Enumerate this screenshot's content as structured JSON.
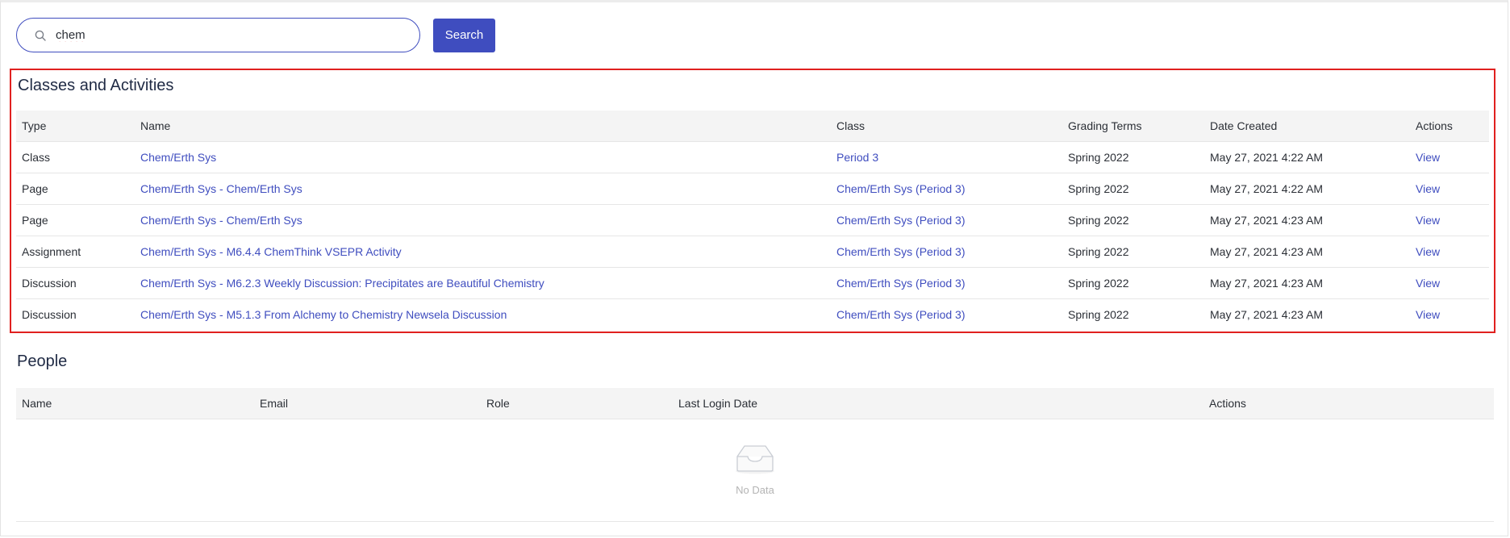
{
  "search": {
    "value": "chem",
    "button_label": "Search"
  },
  "classes": {
    "title": "Classes and Activities",
    "columns": {
      "type": "Type",
      "name": "Name",
      "class": "Class",
      "grading_terms": "Grading Terms",
      "date_created": "Date Created",
      "actions": "Actions"
    },
    "rows": [
      {
        "type": "Class",
        "name": "Chem/Erth Sys",
        "class": "Period 3",
        "grading_terms": "Spring 2022",
        "date_created": "May 27, 2021 4:22 AM",
        "action": "View"
      },
      {
        "type": "Page",
        "name": "Chem/Erth Sys - Chem/Erth Sys",
        "class": "Chem/Erth Sys (Period 3)",
        "grading_terms": "Spring 2022",
        "date_created": "May 27, 2021 4:22 AM",
        "action": "View"
      },
      {
        "type": "Page",
        "name": "Chem/Erth Sys - Chem/Erth Sys",
        "class": "Chem/Erth Sys (Period 3)",
        "grading_terms": "Spring 2022",
        "date_created": "May 27, 2021 4:23 AM",
        "action": "View"
      },
      {
        "type": "Assignment",
        "name": "Chem/Erth Sys - M6.4.4 ChemThink VSEPR Activity",
        "class": "Chem/Erth Sys (Period 3)",
        "grading_terms": "Spring 2022",
        "date_created": "May 27, 2021 4:23 AM",
        "action": "View"
      },
      {
        "type": "Discussion",
        "name": "Chem/Erth Sys - M6.2.3 Weekly Discussion: Precipitates are Beautiful Chemistry",
        "class": "Chem/Erth Sys (Period 3)",
        "grading_terms": "Spring 2022",
        "date_created": "May 27, 2021 4:23 AM",
        "action": "View"
      },
      {
        "type": "Discussion",
        "name": "Chem/Erth Sys - M5.1.3 From Alchemy to Chemistry Newsela Discussion",
        "class": "Chem/Erth Sys (Period 3)",
        "grading_terms": "Spring 2022",
        "date_created": "May 27, 2021 4:23 AM",
        "action": "View"
      }
    ]
  },
  "people": {
    "title": "People",
    "columns": {
      "name": "Name",
      "email": "Email",
      "role": "Role",
      "last_login_date": "Last Login Date",
      "actions": "Actions"
    },
    "empty_text": "No Data"
  },
  "colors": {
    "accent": "#3f4dbf",
    "highlight_border": "#e0201f"
  },
  "icons": {
    "search": "search-icon",
    "empty": "empty-inbox-icon"
  }
}
